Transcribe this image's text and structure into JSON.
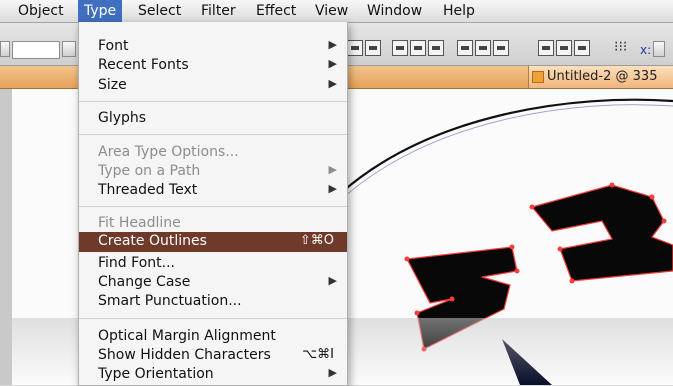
{
  "menubar": {
    "items": [
      "Object",
      "Type",
      "Select",
      "Filter",
      "Effect",
      "View",
      "Window",
      "Help"
    ]
  },
  "document": {
    "title": "Untitled-2 @ 335"
  },
  "toolbar": {
    "x_label": "x:"
  },
  "type_menu": {
    "font": "Font",
    "recent_fonts": "Recent Fonts",
    "size": "Size",
    "glyphs": "Glyphs",
    "area_type_options": "Area Type Options...",
    "type_on_a_path": "Type on a Path",
    "threaded_text": "Threaded Text",
    "fit_headline": "Fit Headline",
    "create_outlines": "Create Outlines",
    "create_outlines_shortcut": "⇧⌘O",
    "find_font": "Find Font...",
    "change_case": "Change Case",
    "smart_punctuation": "Smart Punctuation...",
    "optical_margin_alignment": "Optical Margin Alignment",
    "show_hidden_characters": "Show Hidden Characters",
    "show_hidden_characters_shortcut": "⌥⌘I",
    "type_orientation": "Type Orientation"
  },
  "artwork": {
    "letters": [
      "A",
      "B"
    ]
  },
  "colors": {
    "menu_highlight": "#703a2a",
    "menubar_selected": "#3f6fbe",
    "tab": "#f0b57b"
  }
}
